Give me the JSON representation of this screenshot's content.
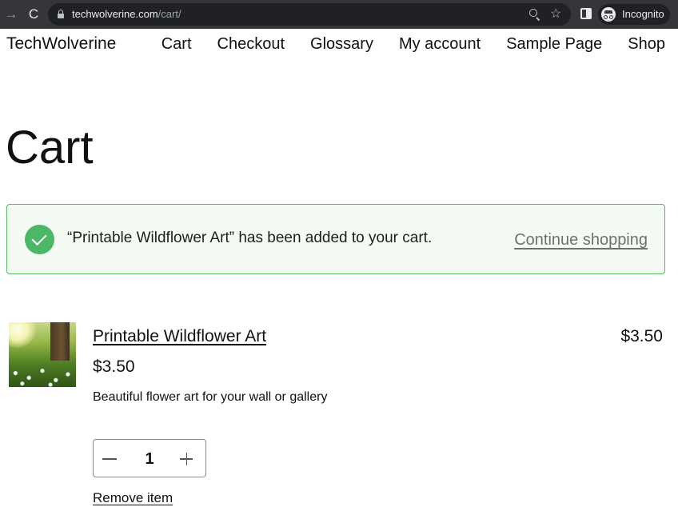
{
  "browser": {
    "url_host": "techwolverine.com",
    "url_path": "/cart/",
    "incognito_label": "Incognito",
    "icons": [
      "back-arrow-icon",
      "reload-icon",
      "lock-icon",
      "zoom-icon",
      "star-icon",
      "side-panel-icon",
      "incognito-icon"
    ]
  },
  "site": {
    "title": "TechWolverine",
    "nav": [
      "Cart",
      "Checkout",
      "Glossary",
      "My account",
      "Sample Page",
      "Shop"
    ]
  },
  "page": {
    "title": "Cart"
  },
  "notice": {
    "message": "“Printable Wildflower Art” has been added to your cart.",
    "link": "Continue shopping",
    "icon": "check-circle-icon",
    "color": "#4ab866"
  },
  "cart": {
    "items": [
      {
        "name": "Printable Wildflower Art",
        "price": "$3.50",
        "description": "Beautiful flower art for your wall or gallery",
        "quantity": "1",
        "total": "$3.50",
        "remove_label": "Remove item"
      }
    ]
  }
}
